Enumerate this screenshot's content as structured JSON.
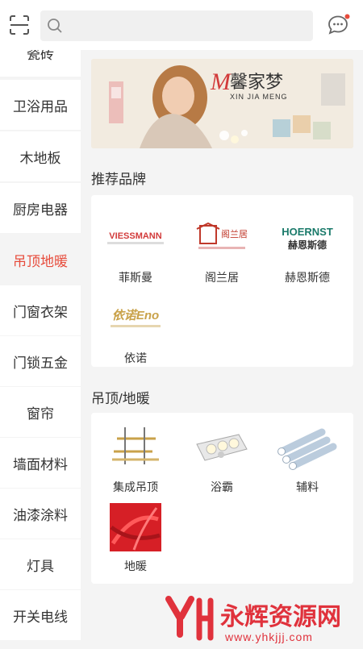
{
  "header": {
    "search_placeholder": "",
    "scan_icon": "scan-icon",
    "message_icon": "chat-bubble-icon",
    "badge_color": "#e74c3c"
  },
  "sidebar": {
    "items": [
      {
        "label": "瓷砖"
      },
      {
        "label": "卫浴用品"
      },
      {
        "label": "木地板"
      },
      {
        "label": "厨房电器"
      },
      {
        "label": "吊顶地暖",
        "active": true
      },
      {
        "label": "门窗衣架"
      },
      {
        "label": "门锁五金"
      },
      {
        "label": "窗帘"
      },
      {
        "label": "墙面材料"
      },
      {
        "label": "油漆涂料"
      },
      {
        "label": "灯具"
      },
      {
        "label": "开关电线"
      }
    ],
    "active_color": "#e74c3c"
  },
  "banner": {
    "brand_cn": "馨家梦",
    "brand_en": "XIN JIA MENG",
    "brand_letter": "M"
  },
  "sections": {
    "brands_title": "推荐品牌",
    "brands": [
      {
        "name": "菲斯曼",
        "logo": "VIESSMANN"
      },
      {
        "name": "阁兰居",
        "logo": "阁兰居"
      },
      {
        "name": "赫恩斯德",
        "logo": "HOERNST",
        "logo_sub": "赫恩斯德"
      },
      {
        "name": "依诺",
        "logo": "依诺Eno"
      }
    ],
    "products_title": "吊顶/地暖",
    "products": [
      {
        "name": "集成吊顶"
      },
      {
        "name": "浴霸"
      },
      {
        "name": "辅料"
      },
      {
        "name": "地暖"
      }
    ]
  },
  "watermark": {
    "text_cn": "永辉资源网",
    "url": "www.yhkjjj.com",
    "color": "#e0323c"
  }
}
